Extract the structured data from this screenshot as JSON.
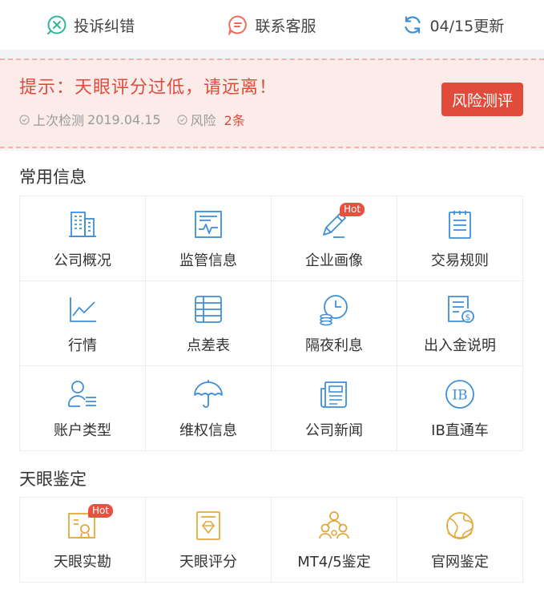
{
  "topbar": {
    "complaint": "投诉纠错",
    "service": "联系客服",
    "update": "04/15更新"
  },
  "warning": {
    "message": "提示：天眼评分过低，请远离！",
    "last_check_label": "上次检测",
    "last_check_date": "2019.04.15",
    "risk_label": "风险",
    "risk_count": "2条",
    "button": "风险测评"
  },
  "common": {
    "title": "常用信息",
    "items": [
      {
        "label": "公司概况",
        "icon": "building-icon"
      },
      {
        "label": "监管信息",
        "icon": "regulation-doc-icon"
      },
      {
        "label": "企业画像",
        "icon": "pen-icon",
        "badge": "Hot"
      },
      {
        "label": "交易规则",
        "icon": "notebook-icon"
      },
      {
        "label": "行情",
        "icon": "line-chart-icon"
      },
      {
        "label": "点差表",
        "icon": "table-icon"
      },
      {
        "label": "隔夜利息",
        "icon": "clock-coins-icon"
      },
      {
        "label": "出入金说明",
        "icon": "money-doc-icon"
      },
      {
        "label": "账户类型",
        "icon": "user-list-icon"
      },
      {
        "label": "维权信息",
        "icon": "umbrella-icon"
      },
      {
        "label": "公司新闻",
        "icon": "newspaper-icon"
      },
      {
        "label": "IB直通车",
        "icon": "ib-badge-icon"
      }
    ]
  },
  "verify": {
    "title": "天眼鉴定",
    "items": [
      {
        "label": "天眼实勘",
        "icon": "certificate-icon",
        "badge": "Hot"
      },
      {
        "label": "天眼评分",
        "icon": "diamond-doc-icon"
      },
      {
        "label": "MT4/5鉴定",
        "icon": "team-icon"
      },
      {
        "label": "官网鉴定",
        "icon": "globe-icon"
      }
    ]
  },
  "colors": {
    "accent_blue": "#3f8fd8",
    "accent_red": "#e04b3c",
    "accent_gold": "#e3a93a"
  }
}
